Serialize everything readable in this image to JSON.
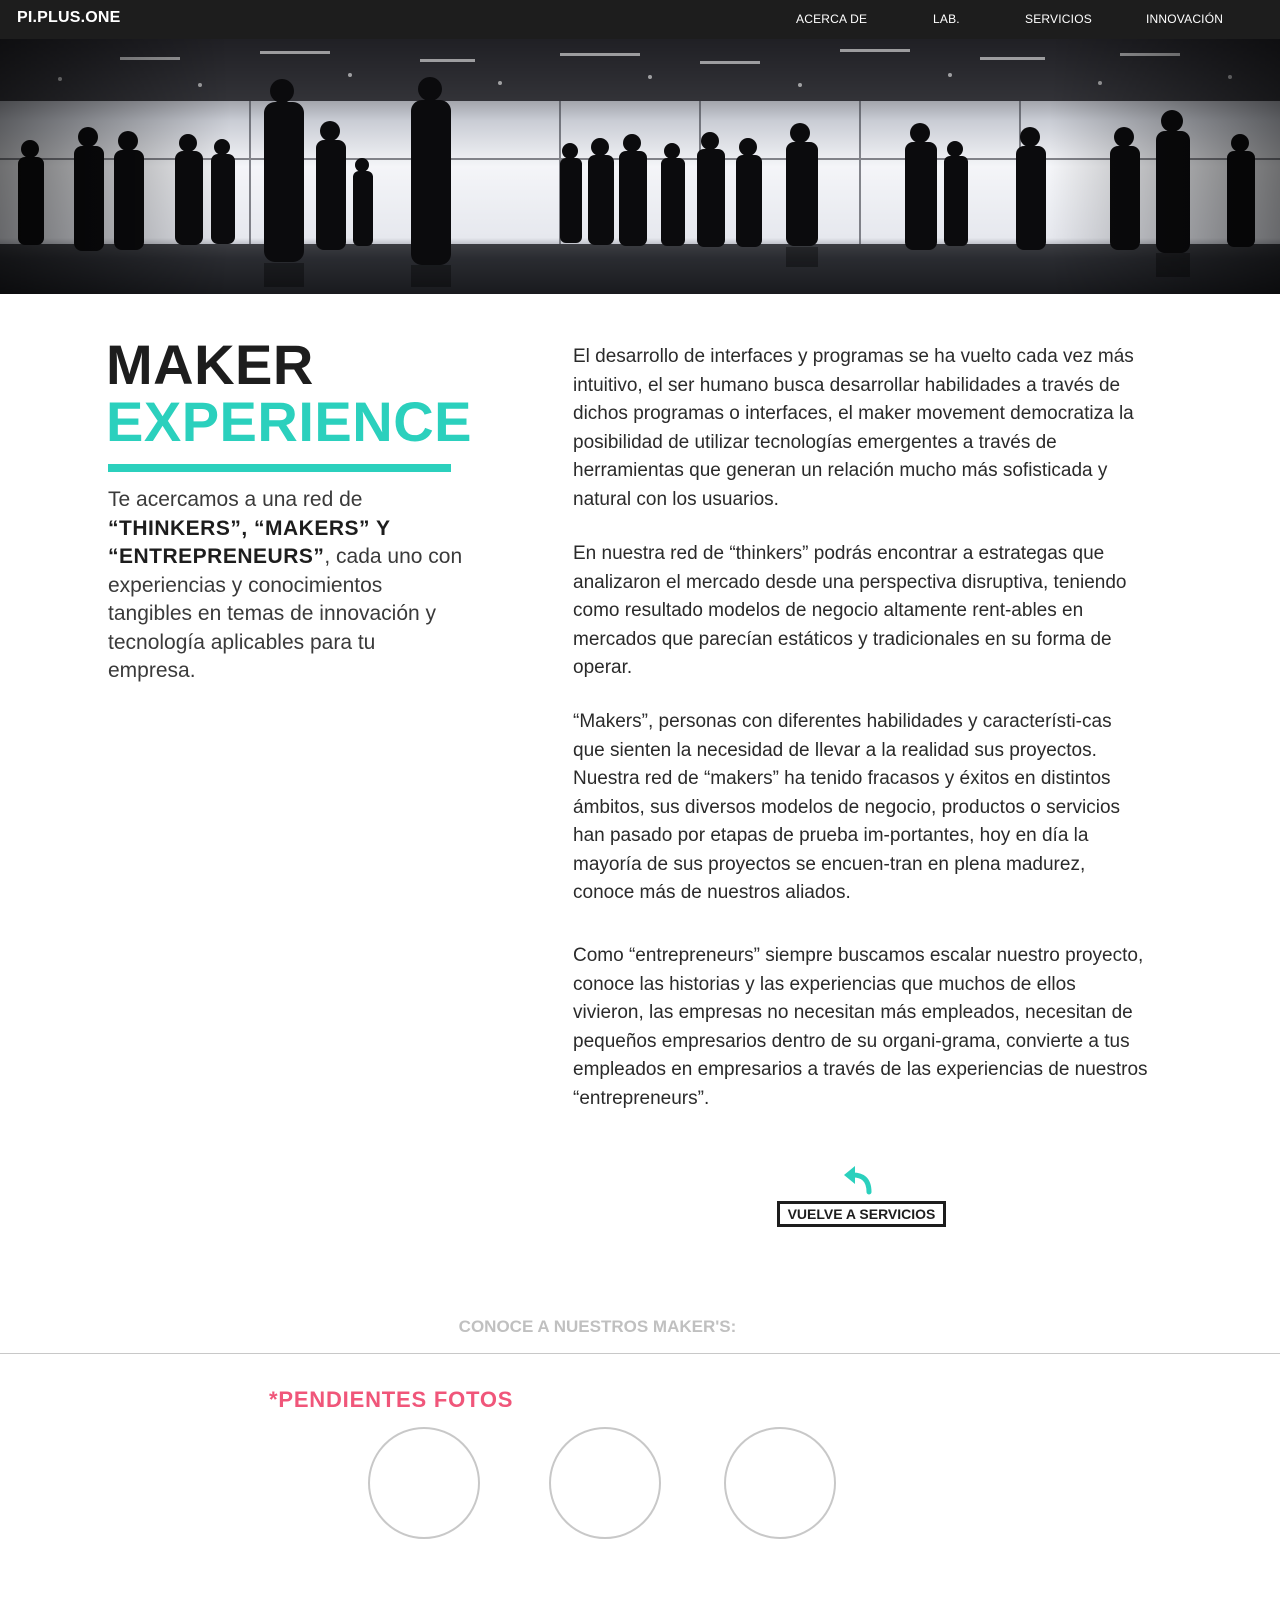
{
  "brand": "PI.PLUS.ONE",
  "nav": {
    "items": [
      {
        "label": "ACERCA DE"
      },
      {
        "label": "LAB."
      },
      {
        "label": "SERVICIOS"
      },
      {
        "label": "INNOVACIÓN"
      }
    ]
  },
  "hero": {
    "description": "Silhouettes of people walking through a bright glass hall"
  },
  "title": {
    "line1": "MAKER",
    "line2": "EXPERIENCE"
  },
  "intro": {
    "prefix": "Te acercamos a una red de ",
    "highlight": "“THINKERS”, “MAKERS” Y “ENTREPRENEURS”",
    "suffix": ", cada uno con experiencias y conocimientos tangibles en temas de innovación y tecnología aplicables para tu empresa."
  },
  "paragraphs": [
    "El desarrollo de interfaces y programas se ha vuelto cada vez más intuitivo, el ser humano busca desarrollar habilidades a través de dichos programas o interfaces, el maker movement democratiza la posibilidad de utilizar tecnologías emergentes a través de herramientas que generan un relación mucho más sofisticada y natural con los usuarios.",
    "En nuestra red de “thinkers” podrás encontrar a estrategas que analizaron el mercado desde una perspectiva disruptiva, teniendo como resultado modelos de negocio altamente rent-ables en mercados que parecían estáticos y tradicionales en su forma de operar.",
    "“Makers”, personas con diferentes habilidades y característi-cas que sienten la necesidad de llevar a la realidad sus proyectos. Nuestra red de “makers” ha tenido fracasos y éxitos en distintos ámbitos, sus diversos modelos de negocio, productos o servicios han pasado por etapas de prueba im-portantes, hoy en día la mayoría de sus proyectos se encuen-tran en plena madurez, conoce más de nuestros aliados.",
    "Como “entrepreneurs” siempre buscamos escalar nuestro proyecto, conoce las historias y las experiencias que muchos de ellos vivieron, las empresas no necesitan más empleados, necesitan de pequeños empresarios dentro de su organi-grama, convierte a tus empleados en empresarios a través de las experiencias de nuestros “entrepreneurs”."
  ],
  "back": {
    "label": "VUELVE A SERVICIOS",
    "icon": "back-arrow-icon"
  },
  "makers": {
    "heading": "CONOCE A NUESTROS MAKER'S:",
    "pending_note": "*PENDIENTES FOTOS",
    "photo_count": 3
  },
  "colors": {
    "accent": "#2bd0bd",
    "dark": "#1d1d1d",
    "pending": "#f0567a",
    "muted": "#c0c0c0"
  }
}
